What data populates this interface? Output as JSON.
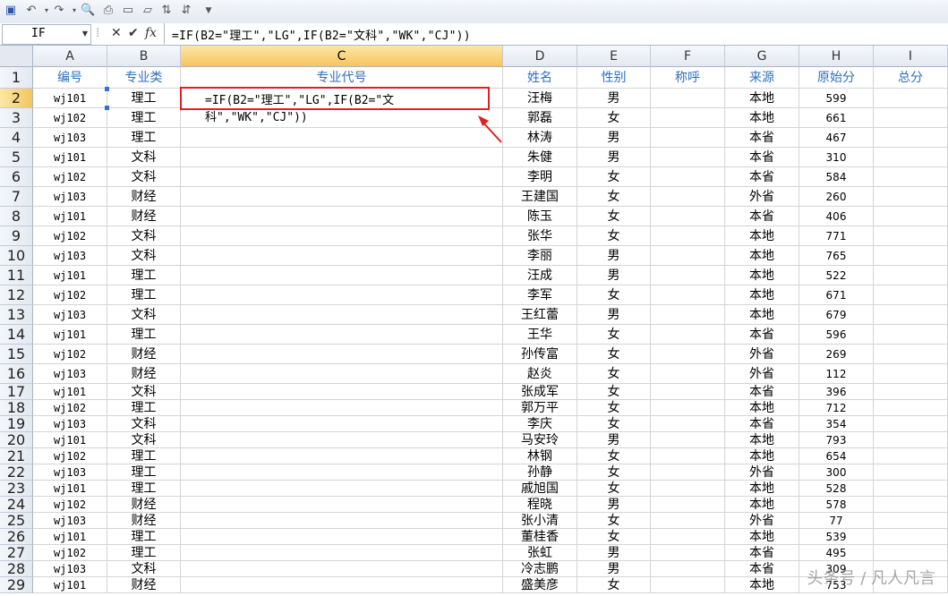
{
  "formula_bar": {
    "name_box": "IF",
    "cancel_symbol": "✕",
    "enter_symbol": "✔",
    "fx_symbol": "fx",
    "formula": "=IF(B2=\"理工\",\"LG\",IF(B2=\"文科\",\"WK\",\"CJ\"))"
  },
  "editing_cell": {
    "text": "=IF(B2=\"理工\",\"LG\",IF(B2=\"文科\",\"WK\",\"CJ\"))"
  },
  "columns": [
    "A",
    "B",
    "C",
    "D",
    "E",
    "F",
    "G",
    "H",
    "I"
  ],
  "header_row": [
    "编号",
    "专业类",
    "专业代号",
    "姓名",
    "性别",
    "称呼",
    "来源",
    "原始分",
    "总分"
  ],
  "rows": [
    [
      "wj101",
      "理工",
      "",
      "汪梅",
      "男",
      "",
      "本地",
      "599",
      ""
    ],
    [
      "wj102",
      "理工",
      "",
      "郭磊",
      "女",
      "",
      "本地",
      "661",
      ""
    ],
    [
      "wj103",
      "理工",
      "",
      "林涛",
      "男",
      "",
      "本省",
      "467",
      ""
    ],
    [
      "wj101",
      "文科",
      "",
      "朱健",
      "男",
      "",
      "本省",
      "310",
      ""
    ],
    [
      "wj102",
      "文科",
      "",
      "李明",
      "女",
      "",
      "本省",
      "584",
      ""
    ],
    [
      "wj103",
      "财经",
      "",
      "王建国",
      "女",
      "",
      "外省",
      "260",
      ""
    ],
    [
      "wj101",
      "财经",
      "",
      "陈玉",
      "女",
      "",
      "本省",
      "406",
      ""
    ],
    [
      "wj102",
      "文科",
      "",
      "张华",
      "女",
      "",
      "本地",
      "771",
      ""
    ],
    [
      "wj103",
      "文科",
      "",
      "李丽",
      "男",
      "",
      "本地",
      "765",
      ""
    ],
    [
      "wj101",
      "理工",
      "",
      "汪成",
      "男",
      "",
      "本地",
      "522",
      ""
    ],
    [
      "wj102",
      "理工",
      "",
      "李军",
      "女",
      "",
      "本地",
      "671",
      ""
    ],
    [
      "wj103",
      "文科",
      "",
      "王红蕾",
      "男",
      "",
      "本地",
      "679",
      ""
    ],
    [
      "wj101",
      "理工",
      "",
      "王华",
      "女",
      "",
      "本省",
      "596",
      ""
    ],
    [
      "wj102",
      "财经",
      "",
      "孙传富",
      "女",
      "",
      "外省",
      "269",
      ""
    ],
    [
      "wj103",
      "财经",
      "",
      "赵炎",
      "女",
      "",
      "外省",
      "112",
      ""
    ],
    [
      "wj101",
      "文科",
      "",
      "张成军",
      "女",
      "",
      "本省",
      "396",
      ""
    ],
    [
      "wj102",
      "理工",
      "",
      "郭万平",
      "女",
      "",
      "本地",
      "712",
      ""
    ],
    [
      "wj103",
      "文科",
      "",
      "李庆",
      "女",
      "",
      "本省",
      "354",
      ""
    ],
    [
      "wj101",
      "文科",
      "",
      "马安玲",
      "男",
      "",
      "本地",
      "793",
      ""
    ],
    [
      "wj102",
      "理工",
      "",
      "林钢",
      "女",
      "",
      "本地",
      "654",
      ""
    ],
    [
      "wj103",
      "理工",
      "",
      "孙静",
      "女",
      "",
      "外省",
      "300",
      ""
    ],
    [
      "wj101",
      "理工",
      "",
      "戚旭国",
      "女",
      "",
      "本地",
      "528",
      ""
    ],
    [
      "wj102",
      "财经",
      "",
      "程晓",
      "男",
      "",
      "本地",
      "578",
      ""
    ],
    [
      "wj103",
      "财经",
      "",
      "张小清",
      "女",
      "",
      "外省",
      "77",
      ""
    ],
    [
      "wj101",
      "理工",
      "",
      "董桂香",
      "女",
      "",
      "本地",
      "539",
      ""
    ],
    [
      "wj102",
      "理工",
      "",
      "张虹",
      "男",
      "",
      "本省",
      "495",
      ""
    ],
    [
      "wj103",
      "文科",
      "",
      "冷志鹏",
      "男",
      "",
      "本省",
      "309",
      ""
    ],
    [
      "wj101",
      "财经",
      "",
      "盛美彦",
      "女",
      "",
      "本地",
      "753",
      ""
    ]
  ],
  "watermark": "头条号 / 凡人凡言"
}
